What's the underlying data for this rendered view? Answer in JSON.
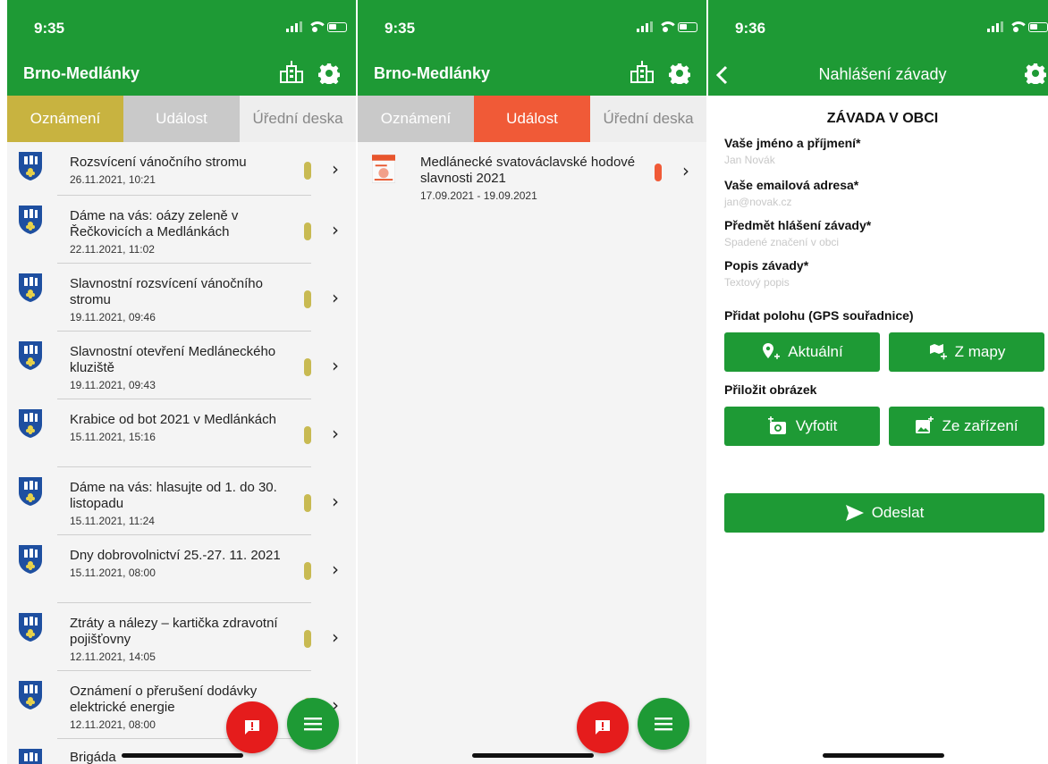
{
  "status": {
    "s1_time": "9:35",
    "s2_time": "9:35",
    "s3_time": "9:36"
  },
  "colors": {
    "brand": "#1e9a35",
    "tab_active_1": "#c8b340",
    "tab_active_2": "#f05a37",
    "tab_inactive": "#c9c9c9",
    "fab_red": "#e51c1c",
    "pill_yellow": "#c8ba52",
    "pill_red": "#f05a37"
  },
  "app": {
    "title": "Brno-Medlánky"
  },
  "tabs": {
    "announcements": "Oznámení",
    "events": "Událost",
    "board": "Úřední deska"
  },
  "announcements": [
    {
      "title": "Rozsvícení vánočního stromu",
      "date": "26.11.2021, 10:21"
    },
    {
      "title": "Dáme na vás: oázy zeleně v Řečkovicích a Medlánkách",
      "date": "22.11.2021, 11:02"
    },
    {
      "title": "Slavnostní rozsvícení vánočního stromu",
      "date": "19.11.2021, 09:46"
    },
    {
      "title": "Slavnostní otevření Medláneckého kluziště",
      "date": "19.11.2021, 09:43"
    },
    {
      "title": "Krabice od bot 2021 v Medlánkách",
      "date": "15.11.2021, 15:16"
    },
    {
      "title": "Dáme na vás: hlasujte od 1. do 30. listopadu",
      "date": "15.11.2021, 11:24"
    },
    {
      "title": "Dny dobrovolnictví 25.-27. 11. 2021",
      "date": "15.11.2021, 08:00"
    },
    {
      "title": "Ztráty a nálezy – kartička zdravotní pojišťovny",
      "date": "12.11.2021, 14:05"
    },
    {
      "title": "Oznámení o přerušení dodávky elektrické energie",
      "date": "12.11.2021, 08:00"
    },
    {
      "title": "Brigáda",
      "date": ""
    }
  ],
  "events": [
    {
      "title": "Medlánecké svatováclavské hodové slavnosti 2021",
      "date": "17.09.2021 - 19.09.2021"
    }
  ],
  "form": {
    "header": "Nahlášení závady",
    "heading": "ZÁVADA V OBCI",
    "name_label": "Vaše jméno a příjmení*",
    "name_placeholder": "Jan Novák",
    "email_label": "Vaše emailová adresa*",
    "email_placeholder": "jan@novak.cz",
    "subject_label": "Předmět hlášení závady*",
    "subject_placeholder": "Spadené značení v obci",
    "desc_label": "Popis závady*",
    "desc_placeholder": "Textový popis",
    "gps_label": "Přidat polohu (GPS souřadnice)",
    "gps_current": "Aktuální",
    "gps_map": "Z mapy",
    "image_label": "Přiložit obrázek",
    "image_photo": "Vyfotit",
    "image_device": "Ze zařízení",
    "submit": "Odeslat"
  }
}
